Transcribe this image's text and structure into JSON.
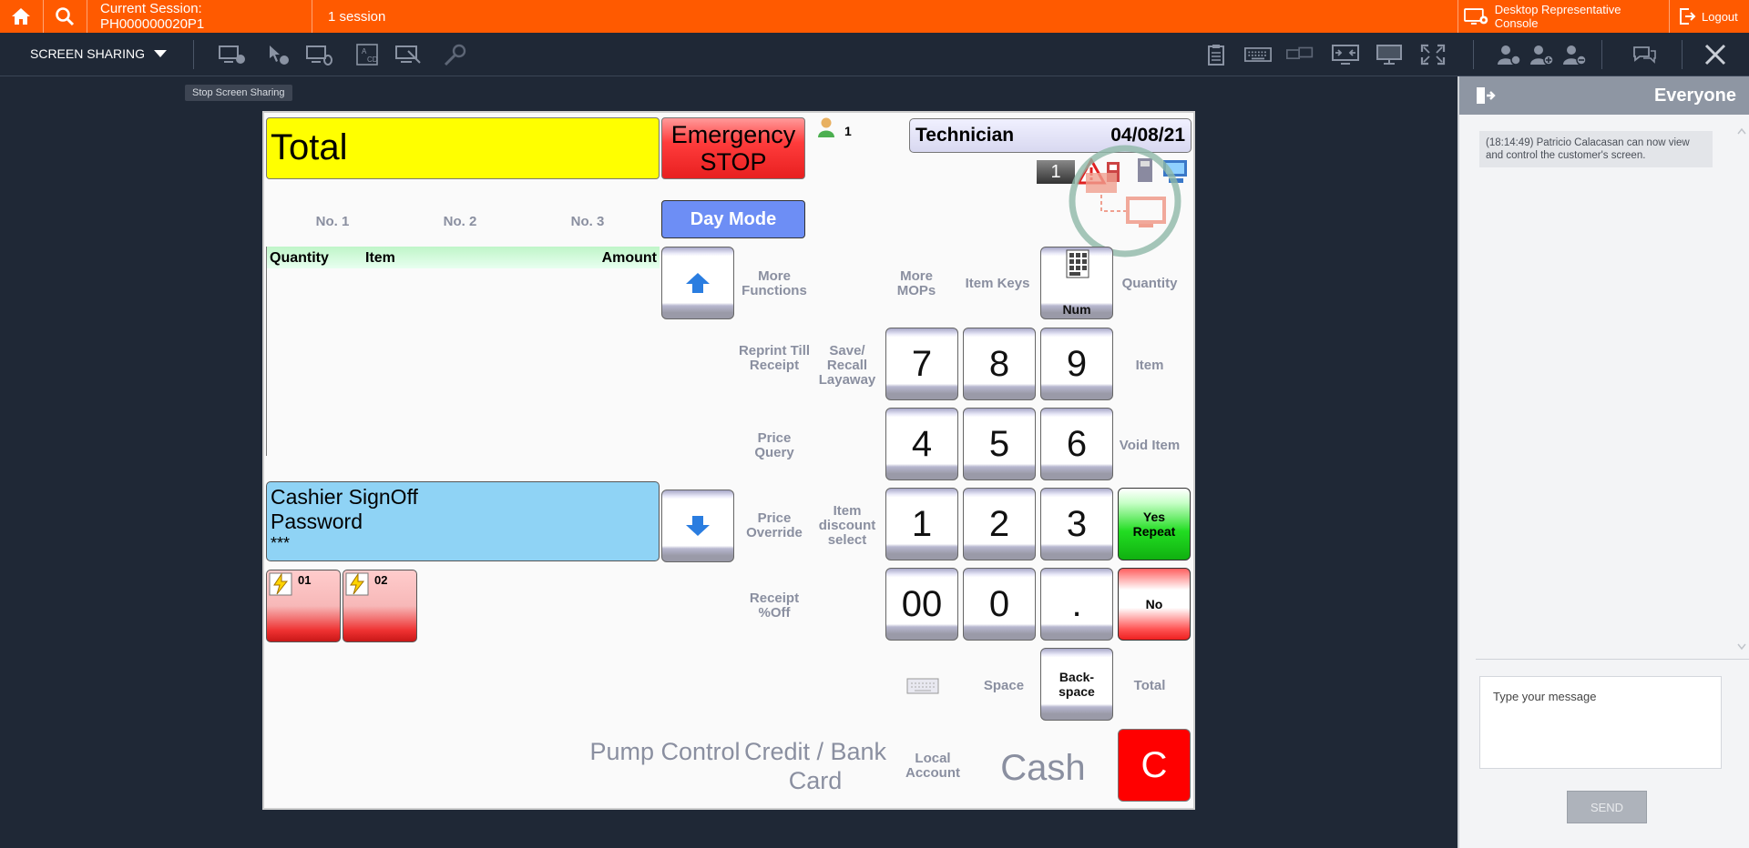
{
  "topbar": {
    "session_label": "Current Session: PH000000020P1",
    "session_count": "1 session",
    "console_label": "Desktop Representative Console",
    "logout_label": "Logout"
  },
  "toolbar": {
    "mode_label": "SCREEN SHARING",
    "tooltip": "Stop Screen Sharing"
  },
  "pos": {
    "total_label": "Total",
    "emergency_line1": "Emergency",
    "emergency_line2": "STOP",
    "user_count": "1",
    "technician_label": "Technician",
    "date": "04/08/21",
    "status_number": "1",
    "day_mode": "Day Mode",
    "tabs": [
      "No. 1",
      "No. 2",
      "No. 3"
    ],
    "columns": {
      "quantity": "Quantity",
      "item": "Item",
      "amount": "Amount"
    },
    "cashier_line1": "Cashier SignOff",
    "cashier_line2": "Password",
    "cashier_line3": "***",
    "pump1": "01",
    "pump2": "02",
    "labels": {
      "more_functions": "More Functions",
      "more_mops": "More MOPs",
      "item_keys": "Item Keys",
      "quantity": "Quantity",
      "reprint": "Reprint Till Receipt",
      "save_recall": "Save/ Recall Layaway",
      "item": "Item",
      "price_query": "Price Query",
      "void_item": "Void Item",
      "price_override": "Price Override",
      "item_discount": "Item discount select",
      "receipt_off": "Receipt %Off",
      "space": "Space",
      "total": "Total",
      "pump_control": "Pump Control",
      "credit_bank": "Credit / Bank Card",
      "local_account": "Local Account",
      "cash": "Cash"
    },
    "keys": {
      "num": "Num",
      "k7": "7",
      "k8": "8",
      "k9": "9",
      "k4": "4",
      "k5": "5",
      "k6": "6",
      "k1": "1",
      "k2": "2",
      "k3": "3",
      "k00": "00",
      "k0": "0",
      "kdot": ".",
      "yes_repeat": "Yes Repeat",
      "no": "No",
      "backspace": "Back-space",
      "clear": "C"
    }
  },
  "chat": {
    "title": "Everyone",
    "message": "(18:14:49) Patricio Calacasan can now view and control the customer's screen.",
    "placeholder": "Type your message",
    "send_label": "SEND"
  },
  "colors": {
    "accent": "#ff5a00",
    "total_bg": "#ffff00",
    "emergency_bg": "#ff3c3c",
    "day_mode_bg": "#6d8ef5",
    "cashier_bg": "#8fd3f5",
    "yes_bg": "#22dd22",
    "no_bg": "#ff5555",
    "clear_bg": "#ff0000"
  }
}
